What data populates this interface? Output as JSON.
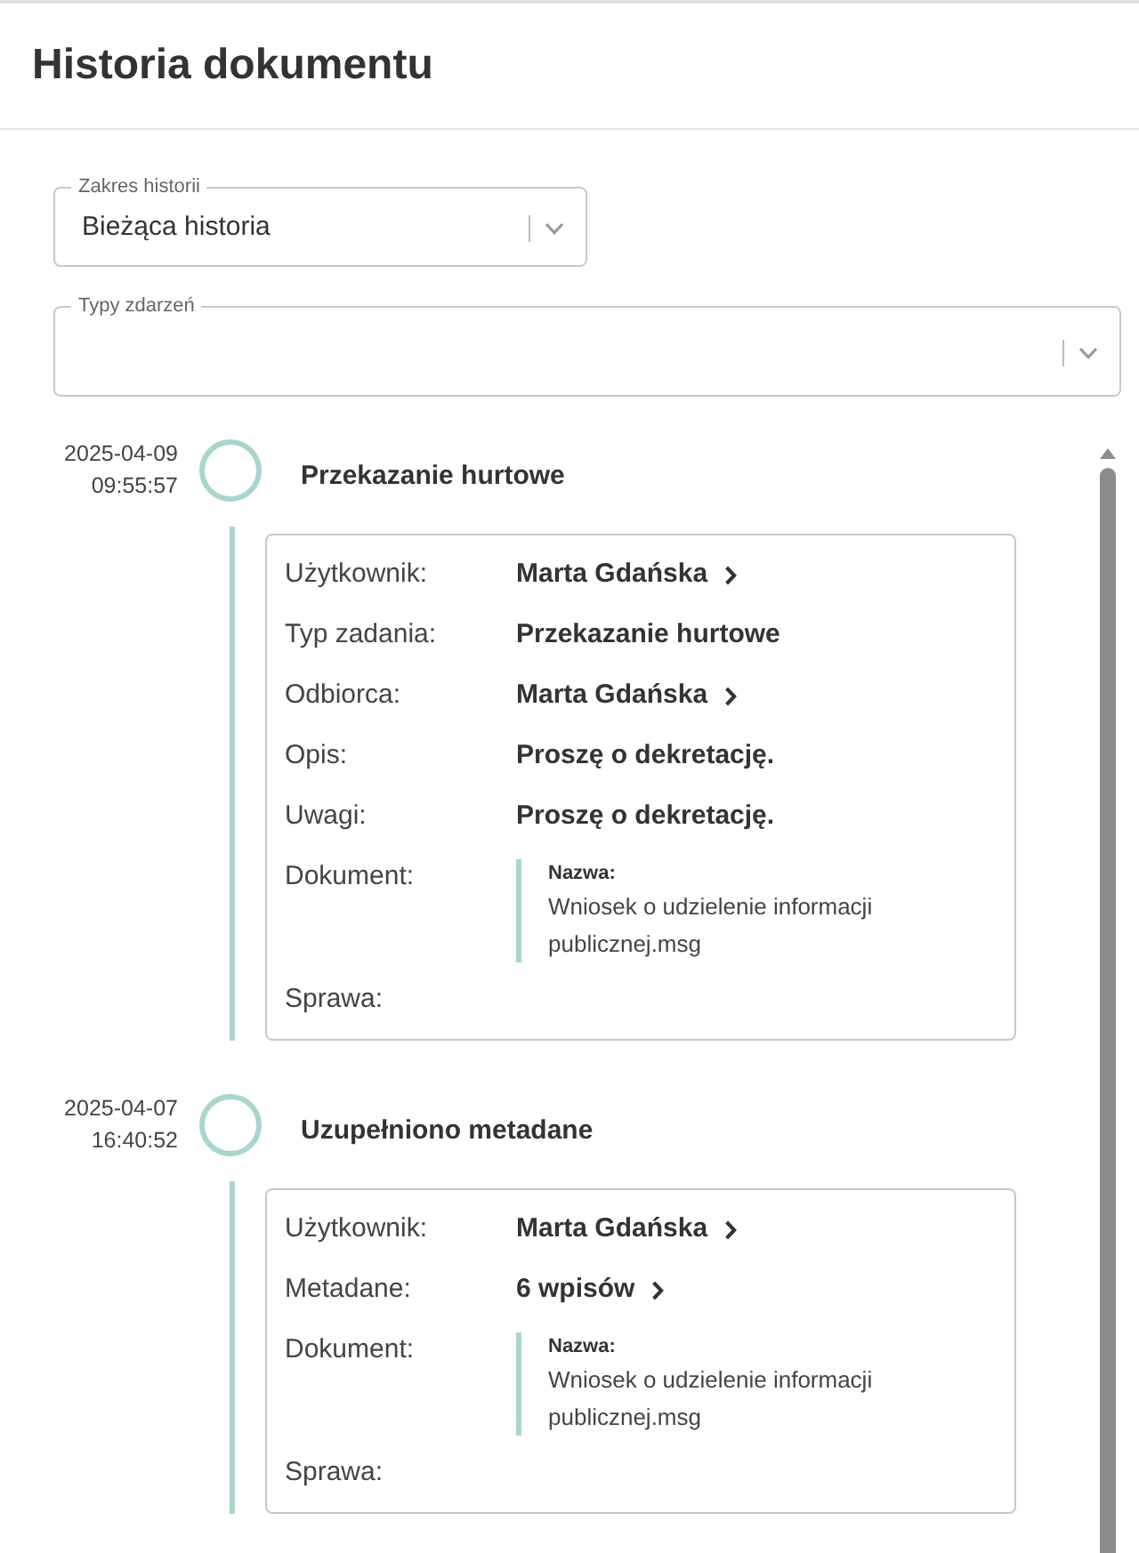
{
  "header": {
    "title": "Historia dokumentu"
  },
  "filters": [
    {
      "label": "Zakres historii",
      "value": "Bieżąca historia"
    },
    {
      "label": "Typy zdarzeń"
    }
  ],
  "events": [
    {
      "date": "2025-04-09",
      "time": "09:55:57",
      "title": "Przekazanie hurtowe",
      "details": [
        {
          "kind": "link",
          "label": "Użytkownik:",
          "value": "Marta Gdańska"
        },
        {
          "kind": "text",
          "label": "Typ zadania:",
          "value": "Przekazanie hurtowe"
        },
        {
          "kind": "link",
          "label": "Odbiorca:",
          "value": "Marta Gdańska"
        },
        {
          "kind": "text",
          "label": "Opis:",
          "value": "Proszę o dekretację."
        },
        {
          "kind": "text",
          "label": "Uwagi:",
          "value": "Proszę o dekretację."
        },
        {
          "kind": "document",
          "label": "Dokument:",
          "name_label": "Nazwa:",
          "value": "Wniosek o udzielenie informacji publicznej.msg"
        },
        {
          "kind": "text",
          "label": "Sprawa:"
        }
      ]
    },
    {
      "date": "2025-04-07",
      "time": "16:40:52",
      "title": "Uzupełniono metadane",
      "details": [
        {
          "kind": "link",
          "label": "Użytkownik:",
          "value": "Marta Gdańska"
        },
        {
          "kind": "link",
          "label": "Metadane:",
          "value": "6 wpisów"
        },
        {
          "kind": "document",
          "label": "Dokument:",
          "name_label": "Nazwa:",
          "value": "Wniosek o udzielenie informacji publicznej.msg"
        },
        {
          "kind": "text",
          "label": "Sprawa:"
        }
      ]
    }
  ]
}
